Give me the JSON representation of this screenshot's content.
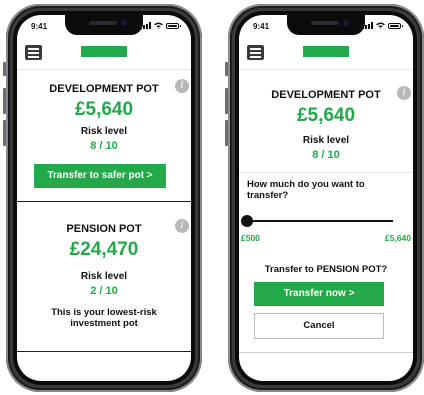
{
  "status": {
    "time": "9:41"
  },
  "left": {
    "development": {
      "title": "DEVELOPMENT POT",
      "amount": "£5,640",
      "risk_label": "Risk level",
      "risk_value": "8 / 10",
      "transfer_button": "Transfer to safer pot >"
    },
    "pension": {
      "title": "PENSION POT",
      "amount": "£24,470",
      "risk_label": "Risk level",
      "risk_value": "2 / 10",
      "note": "This is your lowest-risk investment pot"
    }
  },
  "right": {
    "development": {
      "title": "DEVELOPMENT POT",
      "amount": "£5,640",
      "risk_label": "Risk level",
      "risk_value": "8 / 10"
    },
    "transfer": {
      "question": "How much do you want to transfer?",
      "slider_value_fraction": 0,
      "min_label": "£500",
      "max_label": "£5,640",
      "confirm_text": "Transfer to PENSION POT?",
      "transfer_now_button": "Transfer now >",
      "cancel_button": "Cancel"
    }
  },
  "colors": {
    "accent": "#23a84a",
    "info_icon": "#b8b8b8"
  },
  "icons": {
    "menu": "hamburger-icon",
    "info": "info-icon"
  }
}
